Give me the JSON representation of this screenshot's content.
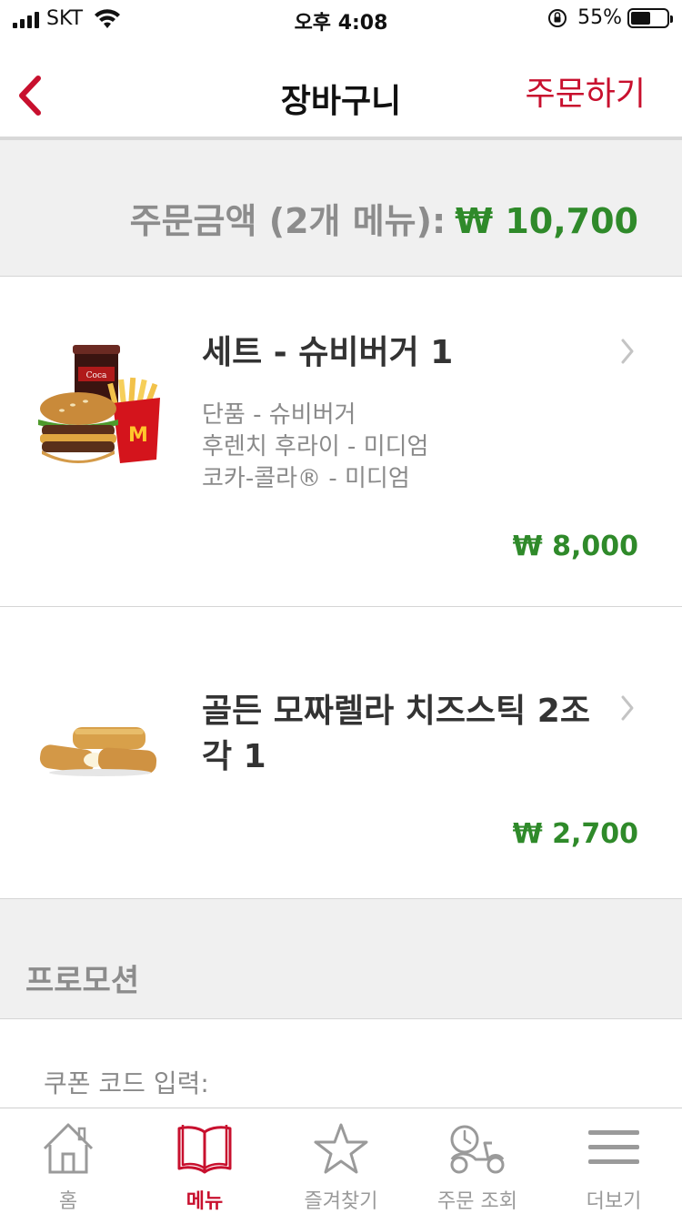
{
  "status_bar": {
    "carrier": "SKT",
    "time": "오후 4:08",
    "battery_percent": "55%",
    "battery_level": 0.55
  },
  "nav": {
    "title": "장바구니",
    "order_label": "주문하기",
    "back_icon": "chevron-left-icon"
  },
  "summary": {
    "label": "주문금액 (2개 메뉴):",
    "value": "₩ 10,700"
  },
  "items": [
    {
      "name": "세트 - 슈비버거 1",
      "details": [
        "단품 - 슈비버거",
        "후렌치 후라이 - 미디엄",
        "코카-콜라® - 미디엄"
      ],
      "price": "₩ 8,000"
    },
    {
      "name": "골든 모짜렐라 치즈스틱 2조각 1",
      "details": [],
      "price": "₩ 2,700"
    }
  ],
  "promotion": {
    "title": "프로모션",
    "coupon_label": "쿠폰 코드 입력:"
  },
  "tabs": [
    {
      "label": "홈",
      "icon": "home-icon",
      "active": false
    },
    {
      "label": "메뉴",
      "icon": "menu-book-icon",
      "active": true
    },
    {
      "label": "즐겨찾기",
      "icon": "star-icon",
      "active": false
    },
    {
      "label": "주문 조회",
      "icon": "delivery-scooter-icon",
      "active": false
    },
    {
      "label": "더보기",
      "icon": "hamburger-menu-icon",
      "active": false
    }
  ],
  "colors": {
    "brand_red": "#c8102e",
    "price_green": "#2f8a2a",
    "muted_gray": "#8c8c8c"
  }
}
